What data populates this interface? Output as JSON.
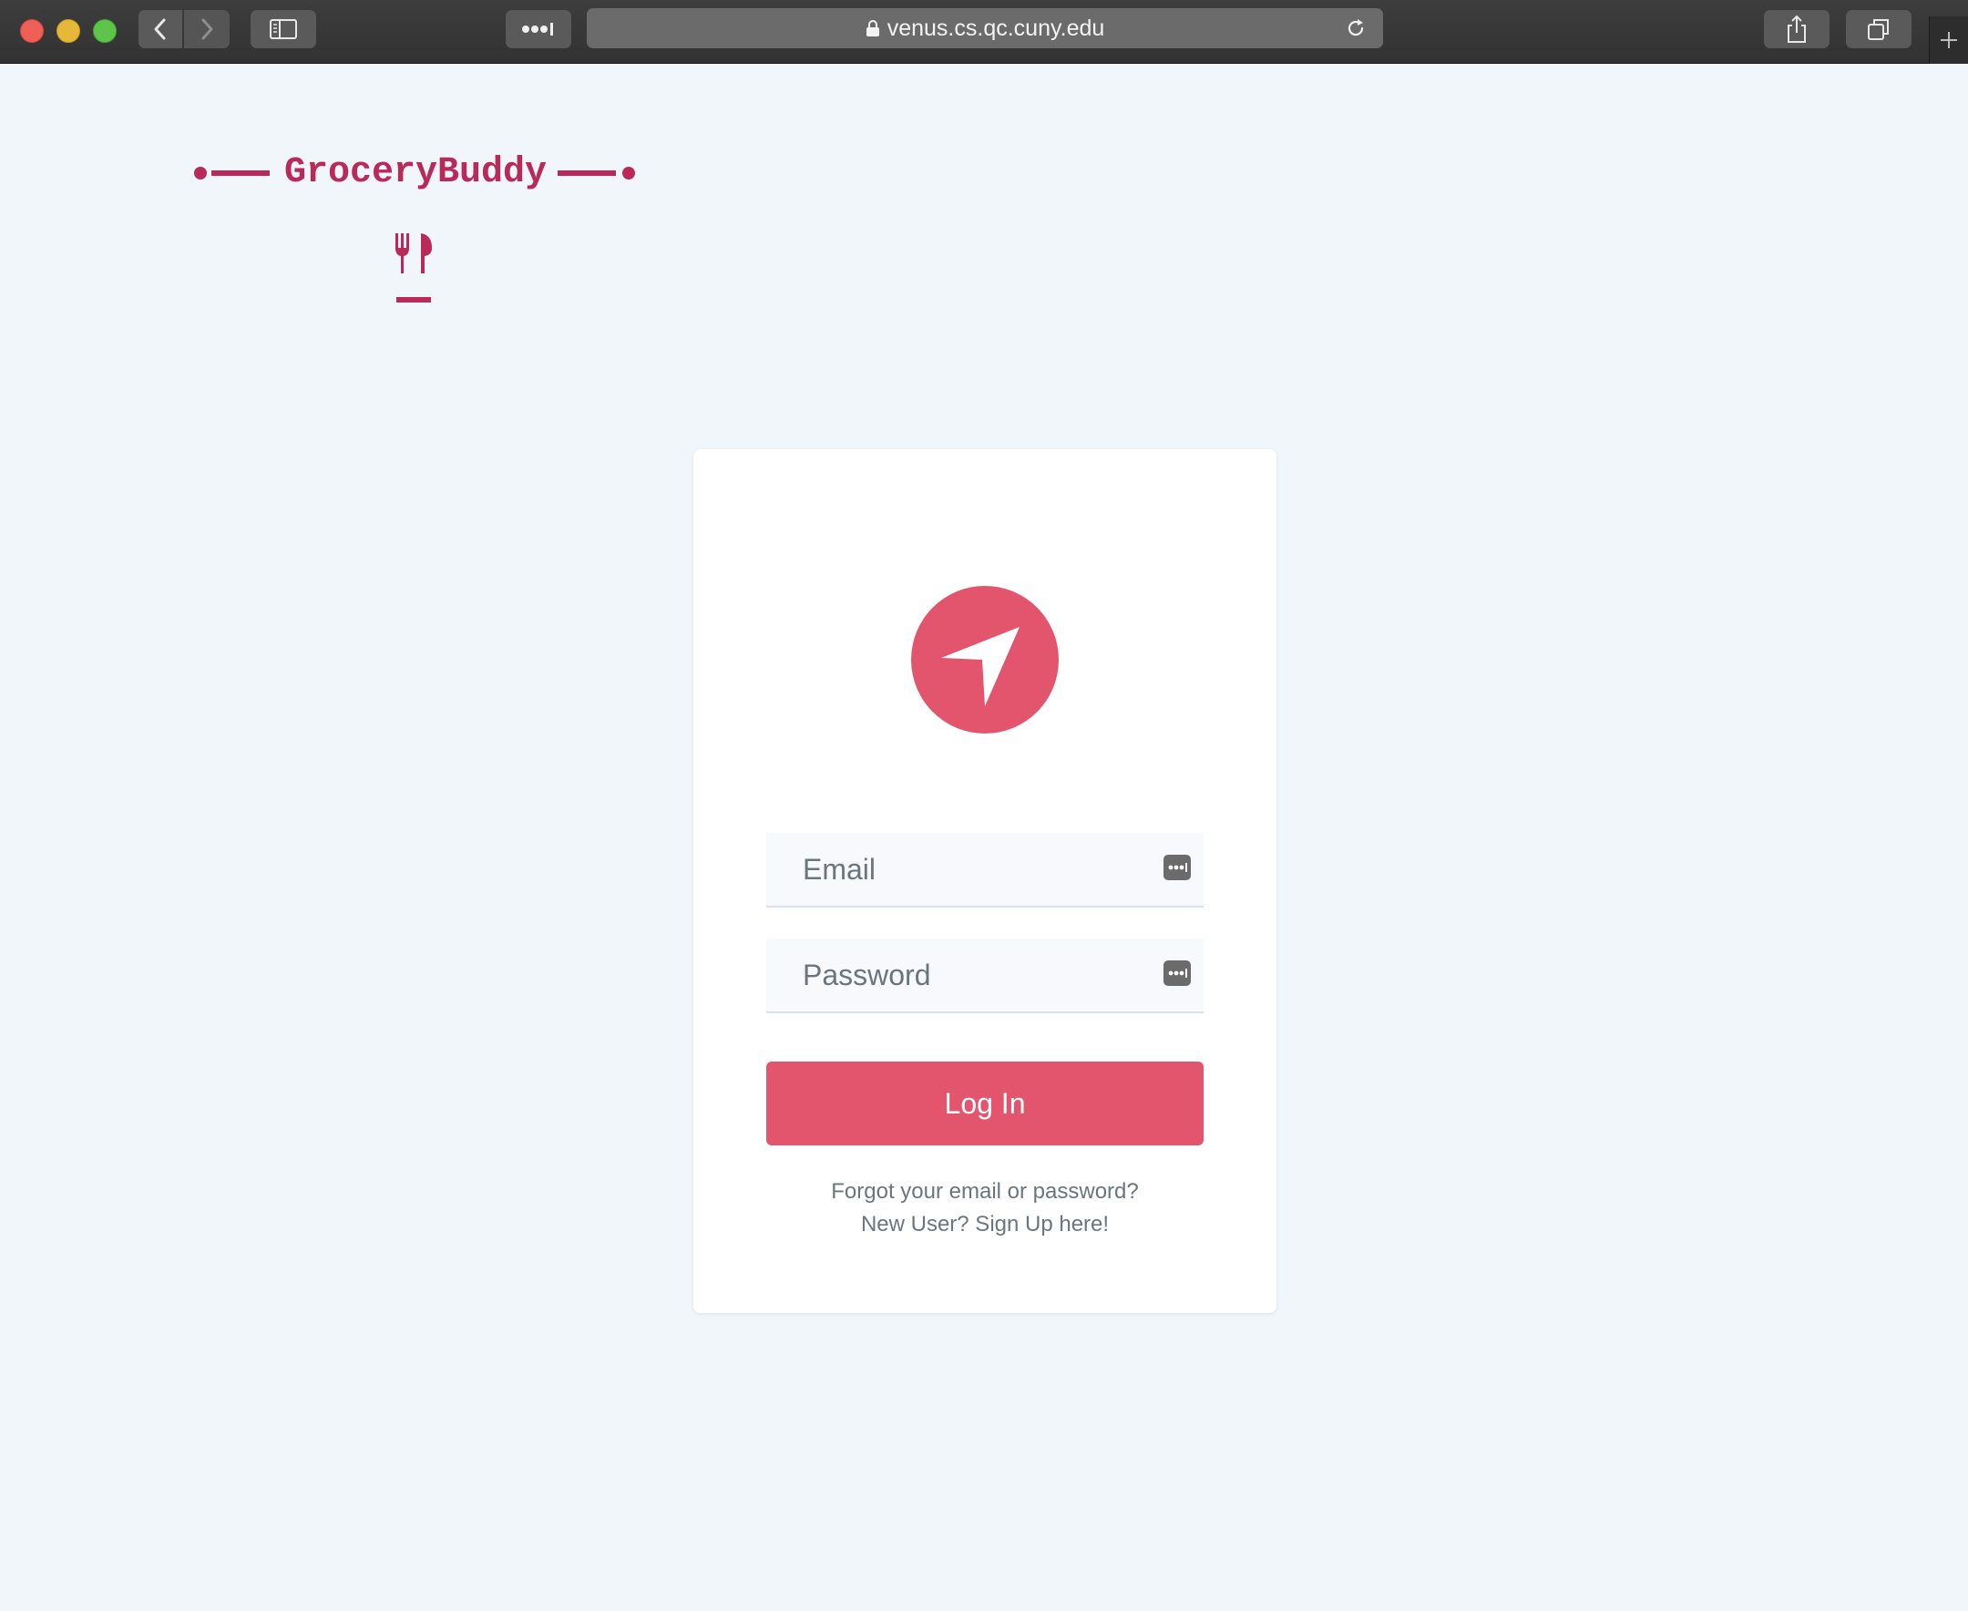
{
  "browser": {
    "url": "venus.cs.qc.cuny.edu",
    "icons": {
      "back": "chevron-left-icon",
      "forward": "chevron-right-icon",
      "sidebar": "sidebar-icon",
      "reader": "reader-dots-icon",
      "lock": "lock-icon",
      "reload": "reload-icon",
      "share": "share-icon",
      "tabs": "tabs-overview-icon",
      "new_tab": "plus-icon"
    }
  },
  "brand": {
    "name": "GroceryBuddy",
    "icon": "fork-knife-icon",
    "color": "#b9295a"
  },
  "login": {
    "avatar_icon": "location-arrow-icon",
    "accent_color": "#e3546d",
    "email_placeholder": "Email",
    "password_placeholder": "Password",
    "autofill_icon": "password-key-icon",
    "submit_label": "Log In",
    "forgot_link": "Forgot your email or password?",
    "signup_link": "New User? Sign Up here!"
  }
}
